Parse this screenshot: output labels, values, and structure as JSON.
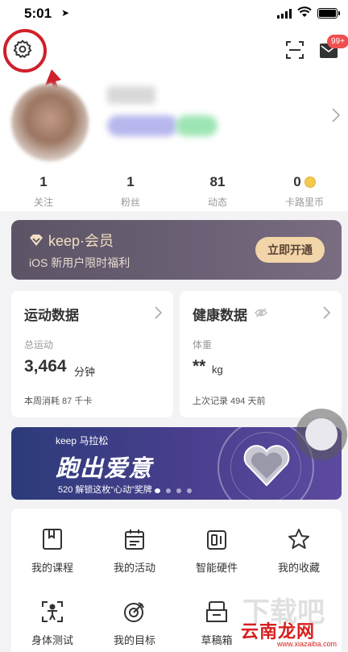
{
  "status_bar": {
    "time": "5:01"
  },
  "header": {
    "notification_badge": "99+"
  },
  "stats": [
    {
      "value": "1",
      "label": "关注"
    },
    {
      "value": "1",
      "label": "粉丝"
    },
    {
      "value": "81",
      "label": "动态"
    },
    {
      "value": "0",
      "label": "卡路里币"
    }
  ],
  "vip": {
    "brand": "keep·会员",
    "subtitle": "iOS 新用户限时福利",
    "button": "立即开通"
  },
  "sport_card": {
    "title": "运动数据",
    "label": "总运动",
    "value": "3,464",
    "unit": "分钟",
    "footer": "本周消耗 87 千卡"
  },
  "health_card": {
    "title": "健康数据",
    "label": "体重",
    "value": "**",
    "unit": "kg",
    "footer": "上次记录 494 天前"
  },
  "banner": {
    "brand": "keep 马拉松",
    "title": "跑出爱意",
    "subtitle": "520 解锁这枚“心动”奖牌"
  },
  "grid": [
    {
      "label": "我的课程",
      "icon": "book-icon"
    },
    {
      "label": "我的活动",
      "icon": "calendar-icon"
    },
    {
      "label": "智能硬件",
      "icon": "device-icon"
    },
    {
      "label": "我的收藏",
      "icon": "star-icon"
    },
    {
      "label": "身体测试",
      "icon": "body-test-icon"
    },
    {
      "label": "我的目标",
      "icon": "target-icon"
    },
    {
      "label": "草稿箱",
      "icon": "drafts-icon"
    }
  ],
  "watermark": {
    "text": "云南龙网",
    "url": "www.xiazaiba.com",
    "bg": "下载吧"
  },
  "colors": {
    "highlight": "#d0202a",
    "vip_gold": "#f2d5a8",
    "badge": "#ef4f4f"
  }
}
